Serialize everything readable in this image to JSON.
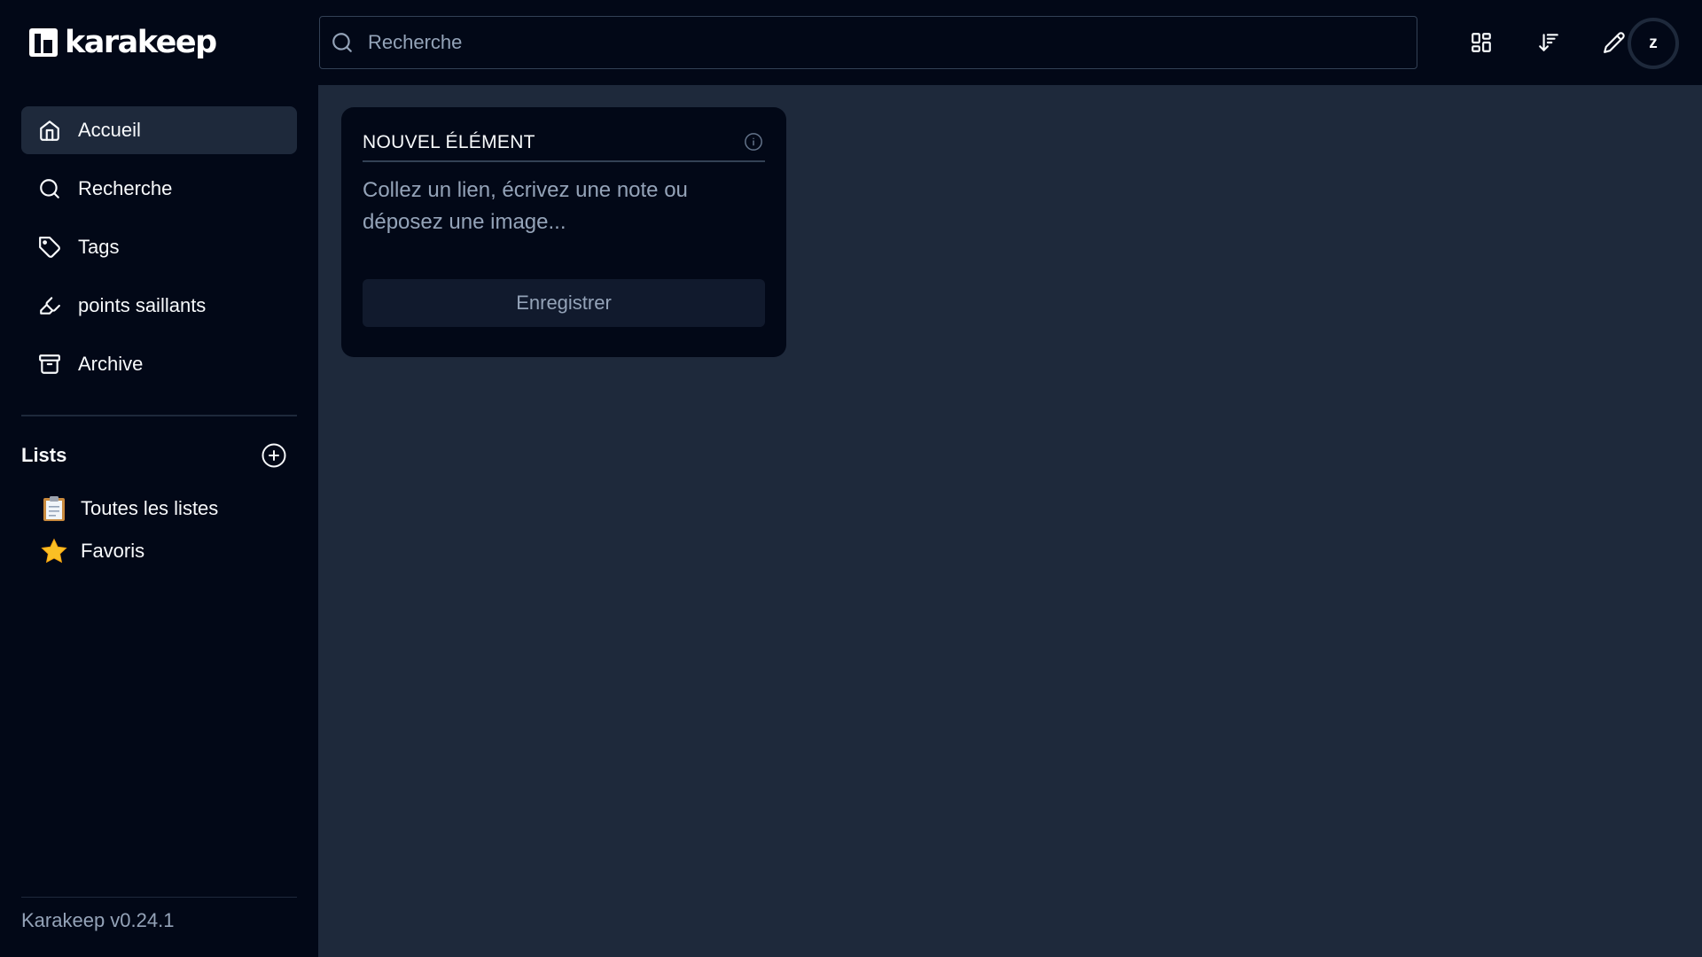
{
  "app": {
    "logo_text": "karakeep",
    "version": "Karakeep v0.24.1"
  },
  "search": {
    "placeholder": "Recherche"
  },
  "sidebar": {
    "items": [
      {
        "label": "Accueil",
        "icon": "home-icon",
        "active": true
      },
      {
        "label": "Recherche",
        "icon": "search-icon",
        "active": false
      },
      {
        "label": "Tags",
        "icon": "tag-icon",
        "active": false
      },
      {
        "label": "points saillants",
        "icon": "highlighter-icon",
        "active": false
      },
      {
        "label": "Archive",
        "icon": "archive-icon",
        "active": false
      }
    ],
    "lists_title": "Lists",
    "lists": [
      {
        "label": "Toutes les listes",
        "icon": "clipboard-icon"
      },
      {
        "label": "Favoris",
        "icon": "star-icon"
      }
    ]
  },
  "header": {
    "avatar_initial": "z",
    "buttons": [
      "layout-grid-icon",
      "sort-icon",
      "pencil-icon"
    ]
  },
  "new_item": {
    "title": "NOUVEL ÉLÉMENT",
    "placeholder": "Collez un lien, écrivez une note ou déposez une image...",
    "save_label": "Enregistrer"
  },
  "colors": {
    "background": "#020817",
    "main_background": "#1e293b",
    "active_item": "#1e293b",
    "muted_text": "#94a3b8",
    "text": "#f8fafc",
    "star": "#fbbf24"
  }
}
